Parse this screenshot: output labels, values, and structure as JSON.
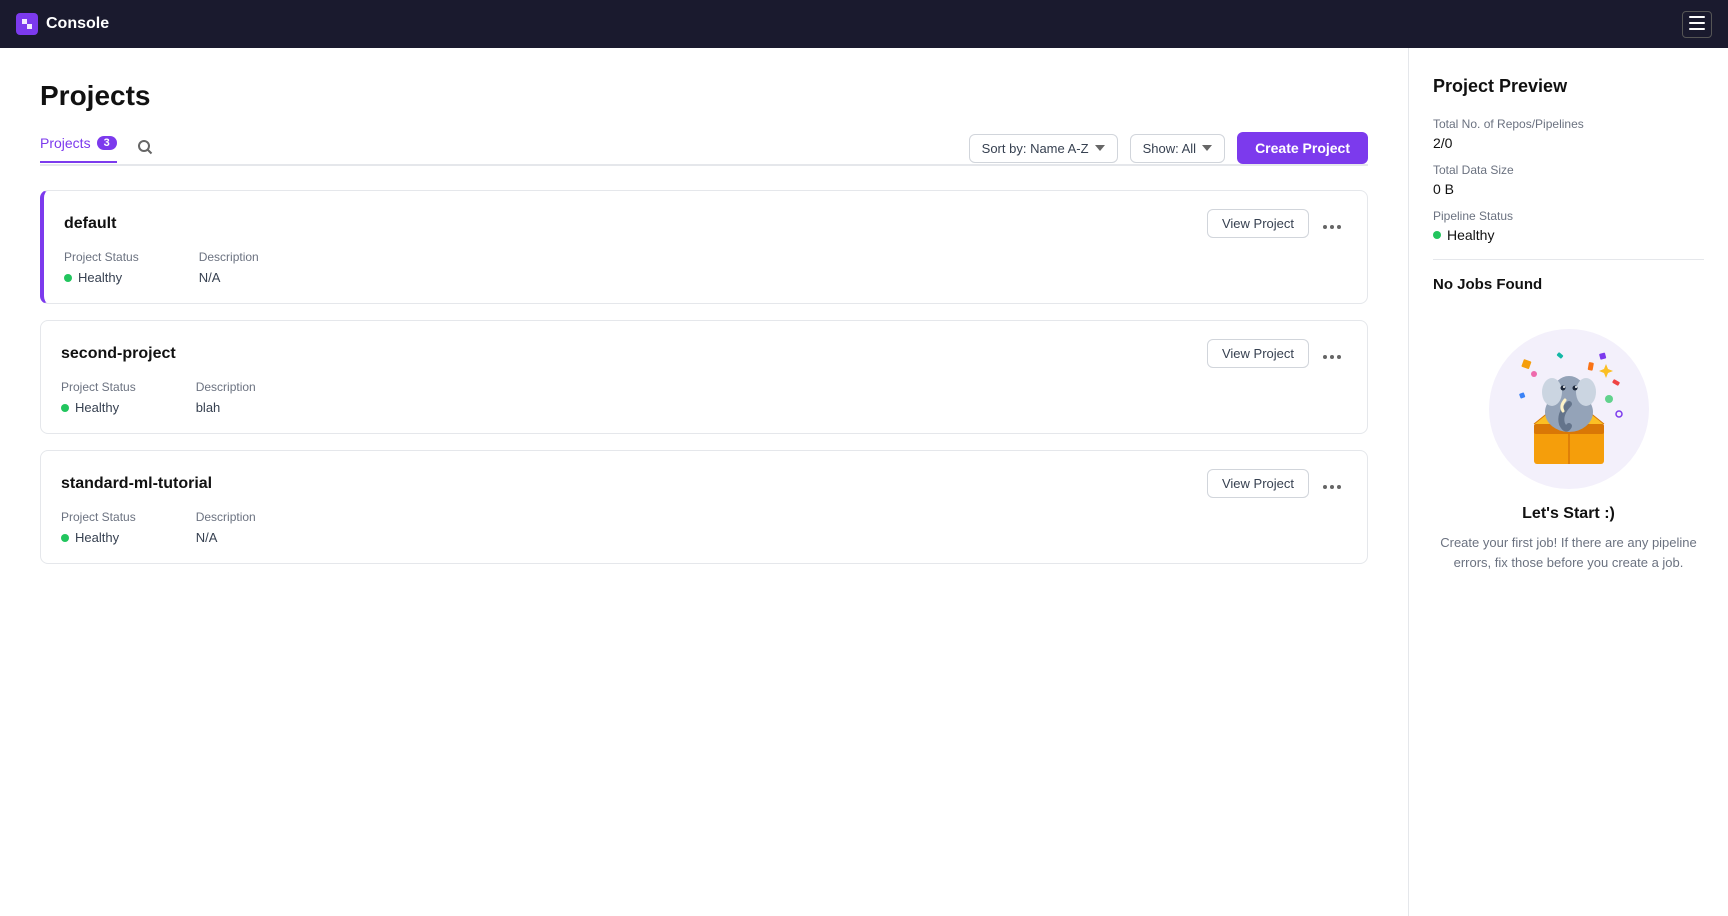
{
  "app": {
    "title": "Console"
  },
  "topnav": {
    "brand": "Console",
    "menu_label": "☰"
  },
  "page": {
    "title": "Projects"
  },
  "tabs": [
    {
      "id": "projects",
      "label": "Projects",
      "count": 3,
      "active": true
    },
    {
      "id": "search",
      "label": "search",
      "is_icon": true
    }
  ],
  "toolbar": {
    "sort_label": "Sort by: Name A-Z",
    "show_label": "Show: All",
    "create_label": "Create Project"
  },
  "projects": [
    {
      "id": "default",
      "name": "default",
      "selected": true,
      "status": "Healthy",
      "description": "N/A",
      "status_label": "Project Status",
      "description_label": "Description",
      "view_btn": "View  Project",
      "more_btn": "..."
    },
    {
      "id": "second-project",
      "name": "second-project",
      "selected": false,
      "status": "Healthy",
      "description": "blah",
      "status_label": "Project Status",
      "description_label": "Description",
      "view_btn": "View  Project",
      "more_btn": "..."
    },
    {
      "id": "standard-ml-tutorial",
      "name": "standard-ml-tutorial",
      "selected": false,
      "status": "Healthy",
      "description": "N/A",
      "status_label": "Project Status",
      "description_label": "Description",
      "view_btn": "View  Project",
      "more_btn": "..."
    }
  ],
  "right_panel": {
    "title": "Project Preview",
    "total_repos_label": "Total No. of Repos/Pipelines",
    "total_repos_value": "2/0",
    "total_data_size_label": "Total Data Size",
    "total_data_size_value": "0 B",
    "pipeline_status_label": "Pipeline Status",
    "pipeline_status_value": "Healthy",
    "no_jobs_title": "No Jobs Found",
    "lets_start": "Let's Start :)",
    "lets_start_desc": "Create your first job! If there are any pipeline errors, fix those before you create a job."
  }
}
